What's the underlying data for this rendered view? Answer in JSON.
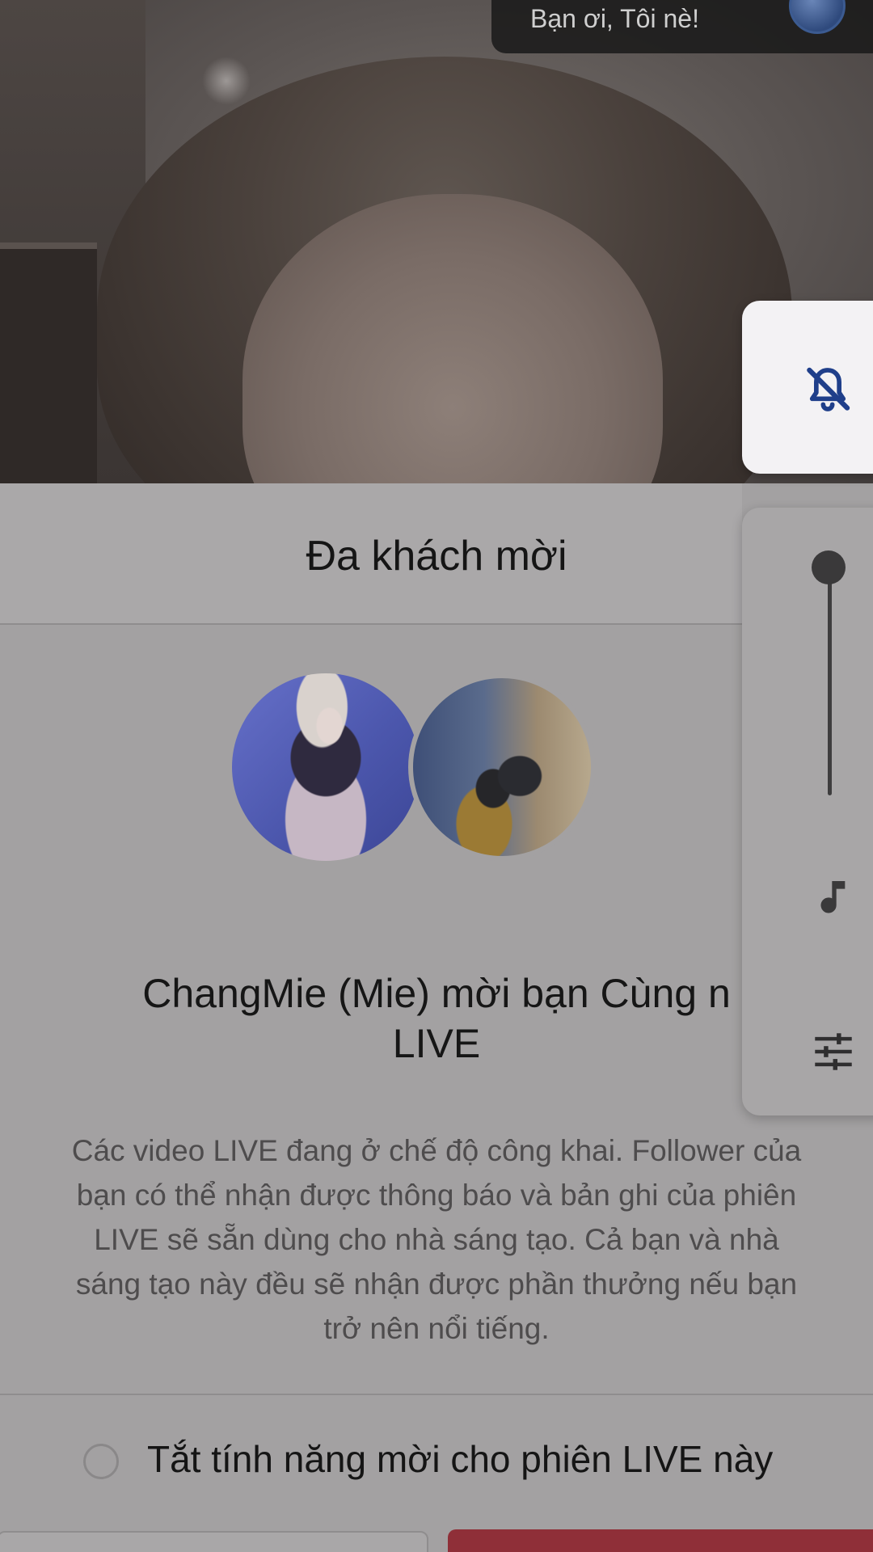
{
  "toast": {
    "text": "Bạn ơi, Tôi nè!",
    "avatar_icon": "avatar-icon"
  },
  "sheet": {
    "title": "Đa khách mời",
    "invite_line1": "ChangMie (Mie) mời bạn Cùng n",
    "invite_line2": "LIVE",
    "description_lines": [
      "Các video LIVE đang ở chế độ công khai. Follower của",
      "bạn có thể nhận được thông báo và bản ghi của phiên",
      "LIVE sẽ sẵn dùng cho nhà sáng tạo. Cả bạn và nhà",
      "sáng tạo này đều sẽ nhận được phần thưởng nếu bạn",
      "trở nên nổi tiếng."
    ],
    "option_label": "Tắt tính năng mời cho phiên LIVE này",
    "option_checked": false
  },
  "controls": {
    "mute_icon": "bell-off-icon",
    "volume_level": 1.0,
    "music_icon": "music-note-icon",
    "settings_icon": "tune-icon"
  },
  "colors": {
    "accent_red": "#8f2f38",
    "mute_icon": "#1f3f8a"
  }
}
